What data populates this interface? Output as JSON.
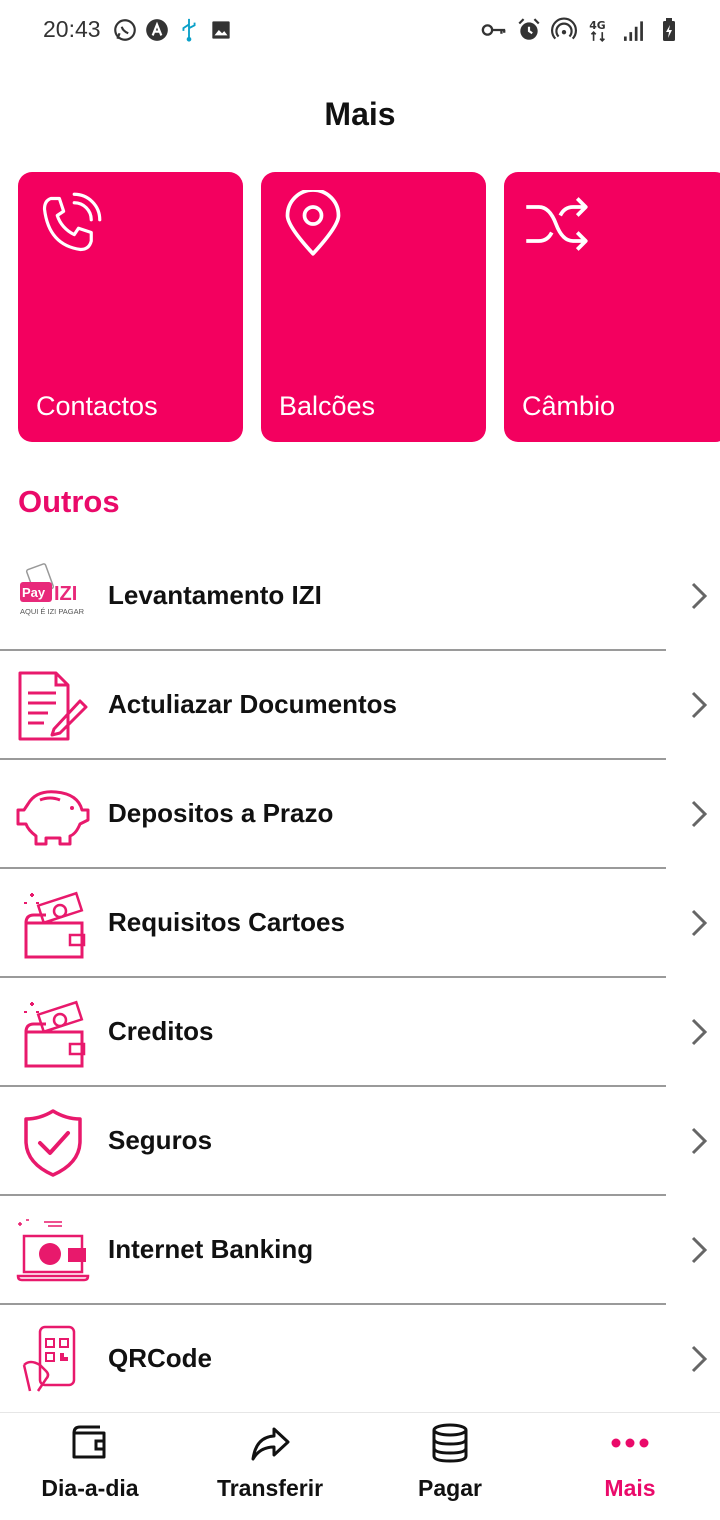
{
  "status_bar": {
    "time": "20:43",
    "left_icons": [
      "whatsapp-icon",
      "a-circle-icon",
      "usb-icon",
      "image-icon"
    ],
    "right_icons": [
      "key-icon",
      "alarm-icon",
      "hotspot-icon",
      "4g-icon",
      "signal-icon",
      "battery-charging-icon"
    ],
    "network_label": "4G"
  },
  "header": {
    "title": "Mais"
  },
  "cards": [
    {
      "label": "Contactos",
      "icon": "phone-icon"
    },
    {
      "label": "Balcões",
      "icon": "location-pin-icon"
    },
    {
      "label": "Câmbio",
      "icon": "shuffle-icon"
    }
  ],
  "section": {
    "title": "Outros"
  },
  "list": [
    {
      "label": "Levantamento IZI",
      "icon": "payizi-logo-icon",
      "logo_text": "Pay IZI",
      "logo_subtext": "AQUI É IZI PAGAR"
    },
    {
      "label": "Actuliazar Documentos",
      "icon": "document-edit-icon"
    },
    {
      "label": "Depositos a Prazo",
      "icon": "piggy-bank-icon"
    },
    {
      "label": "Requisitos Cartoes",
      "icon": "wallet-cash-icon"
    },
    {
      "label": "Creditos",
      "icon": "wallet-cash-icon"
    },
    {
      "label": "Seguros",
      "icon": "shield-check-icon"
    },
    {
      "label": "Internet Banking",
      "icon": "laptop-card-icon"
    },
    {
      "label": "QRCode",
      "icon": "phone-qr-icon"
    }
  ],
  "bottom_nav": [
    {
      "label": "Dia-a-dia",
      "icon": "wallet-icon",
      "active": false
    },
    {
      "label": "Transferir",
      "icon": "share-arrow-icon",
      "active": false
    },
    {
      "label": "Pagar",
      "icon": "coins-stack-icon",
      "active": false
    },
    {
      "label": "Mais",
      "icon": "more-dots-icon",
      "active": true
    }
  ],
  "colors": {
    "accent": "#f3005f",
    "accent_text": "#ea0a6a",
    "text": "#111111",
    "divider": "#9a9a9a"
  }
}
